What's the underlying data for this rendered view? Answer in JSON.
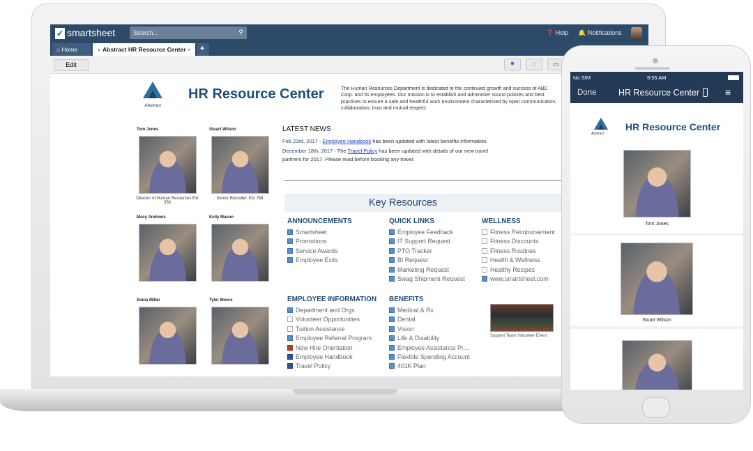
{
  "app": {
    "brand": "smartsheet",
    "search_placeholder": "Search...",
    "help": "Help",
    "notifications": "Notifications"
  },
  "tabs": {
    "home": "Home",
    "active": "Abstract HR Resource Center",
    "add": "+"
  },
  "toolbar": {
    "edit": "Edit"
  },
  "page": {
    "logo_text": "Abstract",
    "title": "HR Resource Center",
    "description": "The Human Resources Department is dedicated to the continued growth and success of ABC Corp. and its employees. Our mission is to establish and administer sound policies and best practices to ensure a safe and healthful work environment characterized by open communication, collaboration, trust and mutual respect.",
    "people": [
      {
        "name": "Tom Jones",
        "caption": "Director of Human Resources Ext 356"
      },
      {
        "name": "Stuart Wilson",
        "caption": "Senior Recruiter, Ext 768"
      },
      {
        "name": "Macy Andrews",
        "caption": ""
      },
      {
        "name": "Kelly Mason",
        "caption": ""
      },
      {
        "name": "Sonia Miller",
        "caption": ""
      },
      {
        "name": "Tyler Moore",
        "caption": ""
      }
    ],
    "news_title": "LATEST NEWS",
    "news": [
      {
        "date": "Feb 23rd, 2017",
        "sep": " - ",
        "pre": "",
        "link": "Employee Handbook",
        "post": " has been updated with latest benefits information."
      },
      {
        "date": "December 18th, 2017",
        "sep": " - ",
        "pre": "The ",
        "link": "Travel Policy",
        "post": " has been updated with details of our new travel partners for 2017. Please read before booking any travel."
      }
    ],
    "key_resources": "Key Resources",
    "sections": [
      {
        "title": "ANNOUNCEMENTS",
        "items": [
          {
            "label": "Smartsheet",
            "icon": "sheet"
          },
          {
            "label": "Promotions",
            "icon": "sheet"
          },
          {
            "label": "Service Awards",
            "icon": "sheet"
          },
          {
            "label": "Employee Exits",
            "icon": "sheet"
          }
        ]
      },
      {
        "title": "QUICK LINKS",
        "items": [
          {
            "label": "Employee Feedback",
            "icon": "sheet"
          },
          {
            "label": "IT Support Request",
            "icon": "sheet"
          },
          {
            "label": "PTO Tracker",
            "icon": "sheet"
          },
          {
            "label": "BI Request",
            "icon": "sheet"
          },
          {
            "label": "Marketing Request",
            "icon": "sheet"
          },
          {
            "label": "Swag Shipment Request",
            "icon": "sheet"
          }
        ]
      },
      {
        "title": "WELLNESS",
        "items": [
          {
            "label": "Fitness Reimbursement",
            "icon": "doc"
          },
          {
            "label": "Fitness Discounts",
            "icon": "image"
          },
          {
            "label": "Fitness Routines",
            "icon": "doc"
          },
          {
            "label": "Health & Wellness",
            "icon": "doc"
          },
          {
            "label": "Healthy Recipes",
            "icon": "doc"
          },
          {
            "label": "www.smartsheet.com",
            "icon": "sheet"
          }
        ]
      },
      {
        "title": "EMPLOYEE INFORMATION",
        "items": [
          {
            "label": "Department and Orgs",
            "icon": "sheet"
          },
          {
            "label": "Volunteer Opportunities",
            "icon": "doc"
          },
          {
            "label": "Tuition Assistance",
            "icon": "doc"
          },
          {
            "label": "Employee Referral Program",
            "icon": "sheet"
          },
          {
            "label": "New Hire Orientation",
            "icon": "ppt"
          },
          {
            "label": "Employee Handbook",
            "icon": "word"
          },
          {
            "label": "Travel Policy",
            "icon": "word"
          }
        ]
      },
      {
        "title": "BENEFITS",
        "items": [
          {
            "label": "Medical & Rx",
            "icon": "sheet"
          },
          {
            "label": "Dental",
            "icon": "sheet"
          },
          {
            "label": "Vision",
            "icon": "sheet"
          },
          {
            "label": "Life & Disability",
            "icon": "sheet"
          },
          {
            "label": "Employee Assistance Pr...",
            "icon": "sheet"
          },
          {
            "label": "Flexible Spending Account",
            "icon": "sheet"
          },
          {
            "label": "401K Plan",
            "icon": "sheet"
          }
        ]
      }
    ],
    "volunteer_caption": "Support Team Volunteer Event"
  },
  "phone": {
    "carrier": "No SIM",
    "time": "9:55 AM",
    "done": "Done",
    "nav_title": "HR Resource Center",
    "logo_text": "Abstract",
    "title": "HR Resource Center",
    "people": [
      "Tom Jones",
      "Stuart Wilson"
    ]
  },
  "colors": {
    "header": "#2e4a69",
    "title": "#1f4e79",
    "phone_bar": "#233a56"
  }
}
